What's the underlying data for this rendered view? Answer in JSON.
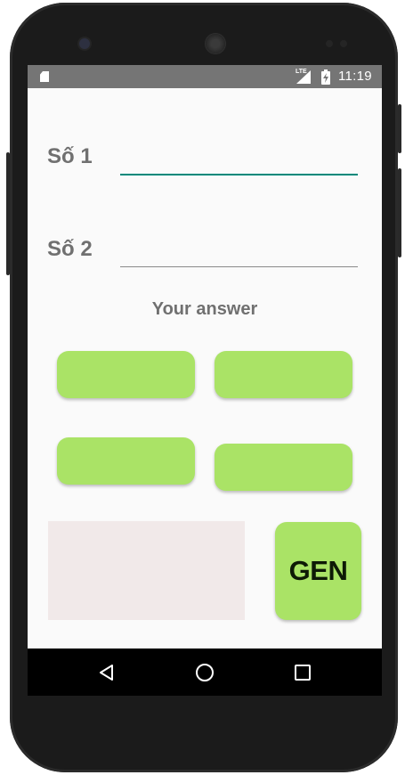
{
  "status_bar": {
    "network_type": "LTE",
    "time": "11:19",
    "icons": [
      "sd-card-icon",
      "signal-icon",
      "battery-charging-icon"
    ]
  },
  "form": {
    "field1": {
      "label": "Số 1",
      "value": "",
      "focused": true
    },
    "field2": {
      "label": "Số 2",
      "value": "",
      "focused": false
    }
  },
  "answer_section": {
    "title": "Your answer",
    "options": [
      "",
      "",
      "",
      ""
    ]
  },
  "result_display": {
    "text": ""
  },
  "gen_button": {
    "label": "GEN"
  },
  "nav_bar": {
    "buttons": [
      "back-icon",
      "home-icon",
      "recents-icon"
    ]
  },
  "colors": {
    "accent": "#00897b",
    "button": "#aae366",
    "result_box": "#f1e9e9",
    "label_text": "#707070",
    "status_bar": "#757575"
  }
}
